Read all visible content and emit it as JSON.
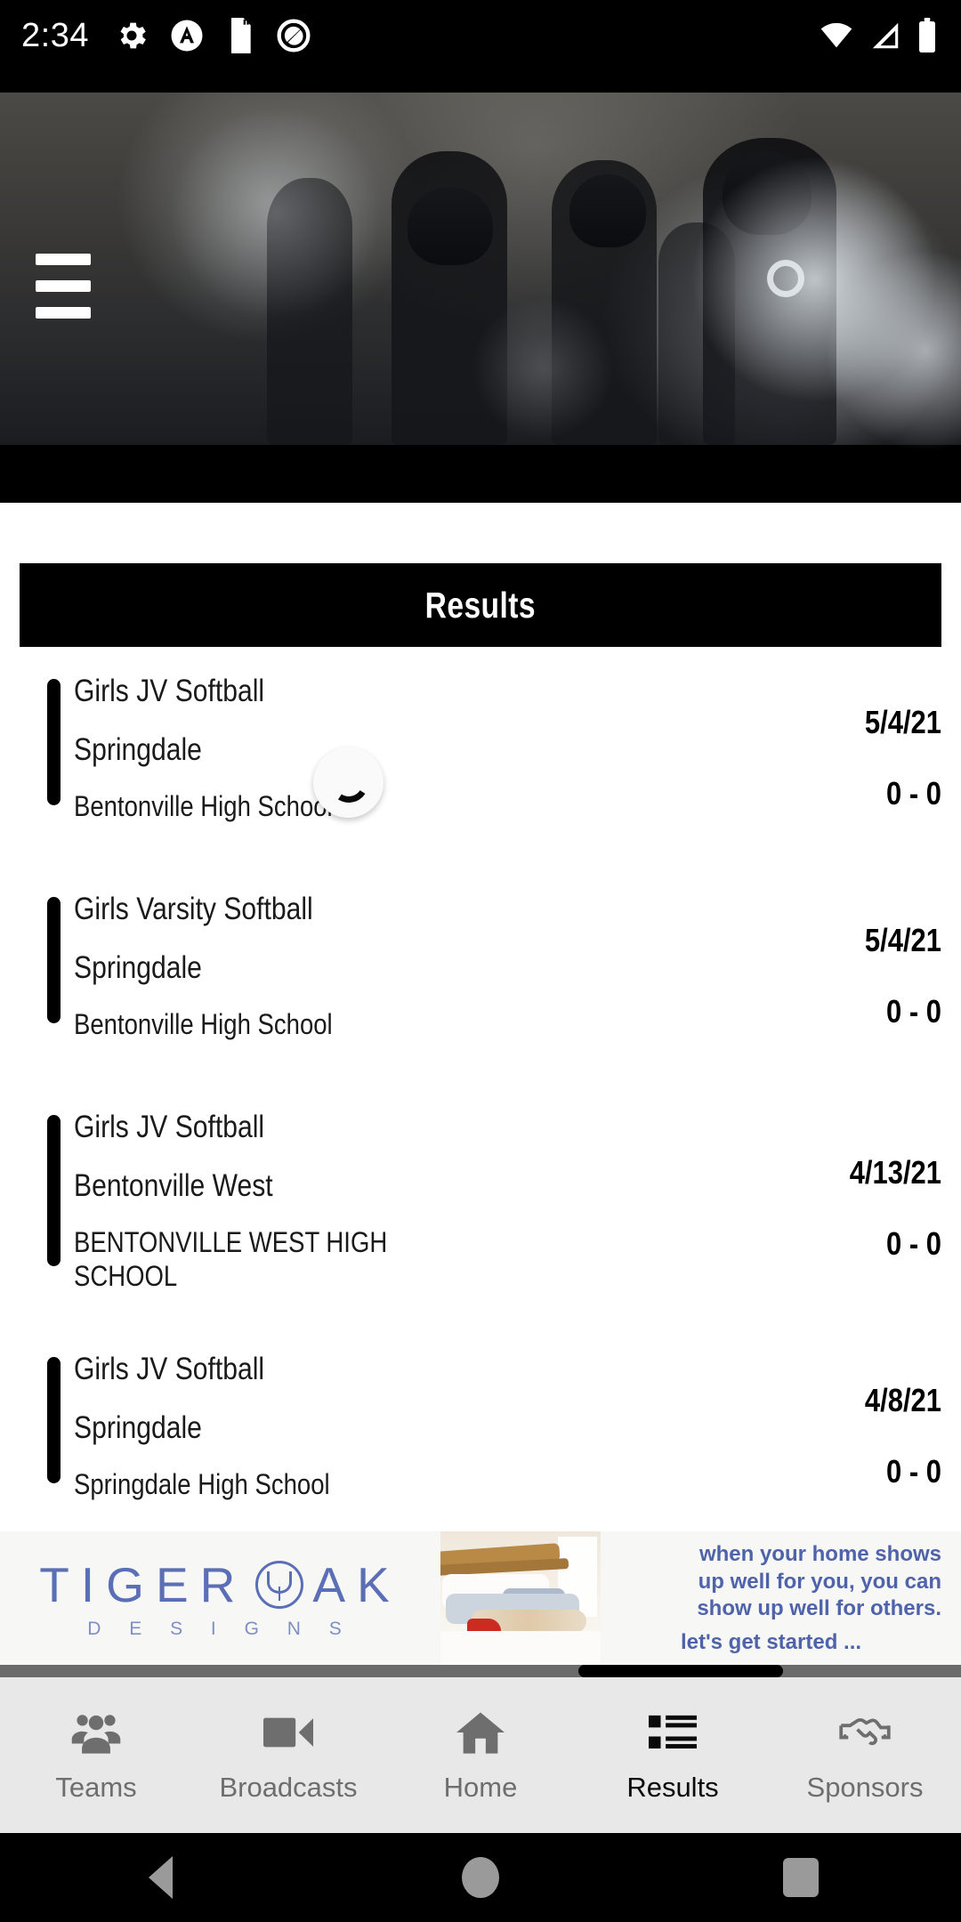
{
  "status_bar": {
    "time": "2:34",
    "left_icons": [
      "gear-icon",
      "circle-a-icon",
      "sd-card-icon",
      "q-circle-icon"
    ],
    "right_icons": [
      "wifi-icon",
      "cell-signal-icon",
      "battery-icon"
    ]
  },
  "hero": {
    "menu_icon": "hamburger-menu-icon",
    "media": "football-team-smoke-video"
  },
  "section": {
    "header_title": "Results"
  },
  "loading": {
    "spinner": "refresh-spinner-icon"
  },
  "results": [
    {
      "sport": "Girls JV Softball",
      "team": "Springdale",
      "opponent": "Bentonville High School",
      "date": "5/4/21",
      "score": "0 - 0"
    },
    {
      "sport": "Girls Varsity Softball",
      "team": "Springdale",
      "opponent": "Bentonville High School",
      "date": "5/4/21",
      "score": "0 - 0"
    },
    {
      "sport": "Girls JV Softball",
      "team": "Bentonville West",
      "opponent": "BENTONVILLE WEST HIGH SCHOOL",
      "date": "4/13/21",
      "score": "0 - 0"
    },
    {
      "sport": "Girls JV Softball",
      "team": "Springdale",
      "opponent": "Springdale High School",
      "date": "4/8/21",
      "score": "0 - 0"
    }
  ],
  "ad": {
    "brand_word_1": "TIGER",
    "brand_word_2": "AK",
    "brand_sub": "D E S I G N S",
    "logo_mark": "tiger-face-circle-icon",
    "photo": "bedroom-interior-photo",
    "copy_line_1": "when your home shows",
    "copy_line_2": "up well for you, you can",
    "copy_line_3": "show up well for others.",
    "cta": "let's get started ..."
  },
  "tabbar": {
    "tabs": [
      {
        "label": "Teams",
        "icon": "people-icon",
        "active": false
      },
      {
        "label": "Broadcasts",
        "icon": "video-camera-icon",
        "active": false
      },
      {
        "label": "Home",
        "icon": "house-icon",
        "active": false
      },
      {
        "label": "Results",
        "icon": "list-icon",
        "active": true
      },
      {
        "label": "Sponsors",
        "icon": "handshake-icon",
        "active": false
      }
    ]
  },
  "android_nav": {
    "back": "back-triangle-icon",
    "home": "home-circle-icon",
    "recents": "recents-square-icon"
  },
  "colors": {
    "banner_bg": "#000000",
    "accent_bar": "#000000",
    "tabbar_bg": "#e8e8e8",
    "tab_inactive": "#6e6e6e",
    "tab_active": "#0a0a0a",
    "ad_blue": "#4f63ab"
  }
}
